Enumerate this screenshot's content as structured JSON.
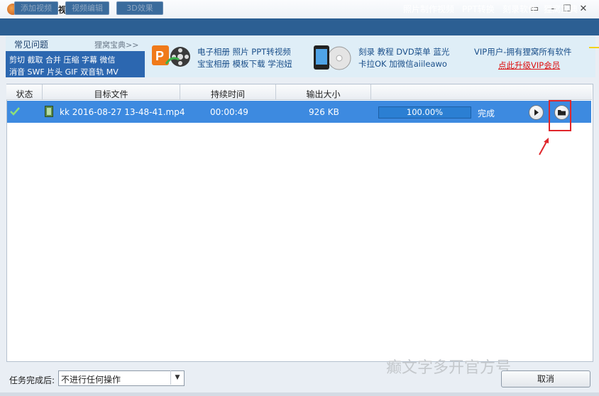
{
  "window": {
    "title": "狸窝全能视频转换器",
    "controls": [
      "▭",
      "—",
      "☐",
      "✕"
    ]
  },
  "toolbar": {
    "buttons": [
      "添加视频",
      "视频编辑",
      "3D效果"
    ],
    "links": [
      "照片制作视频",
      "PPT转换",
      "刻录软件",
      "狸窝宝典"
    ]
  },
  "banner": {
    "faq_title": "常见问题",
    "faq_more": "狸窝宝典>>",
    "faq_line1": "剪切 截取 合并 压缩 字幕 微信",
    "faq_line2": "消音 SWF 片头 GIF 双音轨 MV",
    "promo1_line1": "电子相册 照片 PPT转视频",
    "promo1_line2": "宝宝相册 模板下载 学泡妞",
    "promo2_line1": "刻录 教程 DVD菜单 蓝光",
    "promo2_line2": "卡拉OK 加微信aiileawo",
    "vip_text": "VIP用户-拥有狸窝所有软件",
    "vip_link": "点此升级VIP会员"
  },
  "table": {
    "headers": [
      "状态",
      "目标文件",
      "持续时间",
      "输出大小"
    ],
    "rows": [
      {
        "status_icon": "check-icon",
        "file": "kk 2016-08-27 13-48-41.mp4",
        "duration": "00:00:49",
        "size": "926 KB",
        "progress": "100.00%",
        "progress_value": 100,
        "state": "完成"
      }
    ]
  },
  "footer": {
    "label": "任务完成后:",
    "select_value": "不进行任何操作",
    "cancel": "取消"
  },
  "watermark": "癫文字多开官方号",
  "colors": {
    "toolbar": "#2c5f93",
    "row_selected": "#3d8ae0",
    "faq_body": "#2c67b0",
    "annotation": "#e0262b"
  }
}
